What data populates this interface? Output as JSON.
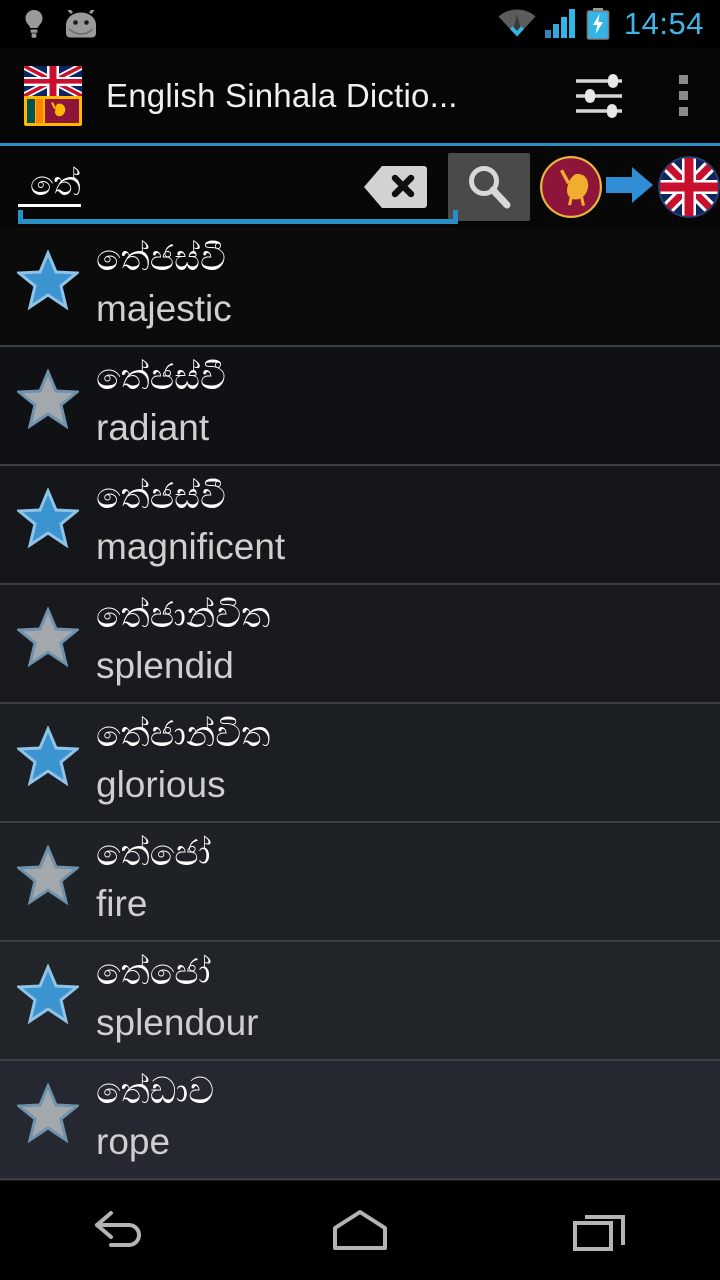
{
  "status_bar": {
    "left_icons": [
      {
        "name": "lightbulb-icon",
        "label": "lightbulb"
      },
      {
        "name": "android-face-icon",
        "label": "android"
      }
    ],
    "right_icons": [
      {
        "name": "wifi-icon",
        "label": "wifi"
      },
      {
        "name": "cellular-signal-icon",
        "label": "signal"
      },
      {
        "name": "battery-charging-icon",
        "label": "battery charging"
      }
    ],
    "clock": "14:54",
    "clock_color": "#41b4e6"
  },
  "action_bar": {
    "app_icon_name": "uk-srilanka-flag-icon",
    "title": "English Sinhala Dictio...",
    "tune_icon_name": "tune-sliders-icon",
    "overflow_icon_name": "overflow-menu-icon",
    "divider_color": "#2a8fc4"
  },
  "search": {
    "value": "තේ",
    "placeholder": "",
    "clear_icon_name": "clear-backspace-icon",
    "search_icon_name": "search-icon",
    "source_lang_icon_name": "sri-lanka-lion-flag-icon",
    "direction_icon_name": "arrow-right-icon",
    "target_lang_icon_name": "uk-flag-icon",
    "underline_color": "#2a8fc4"
  },
  "list": {
    "rows": [
      {
        "sinhala": "තේජස්වී",
        "english": "majestic",
        "starred": true,
        "star_color": "#3b93d0"
      },
      {
        "sinhala": "තේජස්වී",
        "english": "radiant",
        "starred": false,
        "star_color": "#a3a8ac"
      },
      {
        "sinhala": "තේජස්වී",
        "english": "magnificent",
        "starred": true,
        "star_color": "#3b93d0"
      },
      {
        "sinhala": "තේජාන්විත",
        "english": "splendid",
        "starred": false,
        "star_color": "#a3a8ac"
      },
      {
        "sinhala": "තේජාන්විත",
        "english": "glorious",
        "starred": true,
        "star_color": "#3b93d0"
      },
      {
        "sinhala": "තේජෝ",
        "english": "fire",
        "starred": false,
        "star_color": "#a3a8ac"
      },
      {
        "sinhala": "තේජෝ",
        "english": "splendour",
        "starred": true,
        "star_color": "#3b93d0"
      },
      {
        "sinhala": "තේඩාව",
        "english": "rope",
        "starred": false,
        "star_color": "#a3a8ac"
      }
    ],
    "row_backgrounds": [
      "#0b0b0c",
      "#101114",
      "#141619",
      "#181a1e",
      "#1b1e22",
      "#1e2126",
      "#212429",
      "#252830"
    ]
  },
  "nav_bar": {
    "back_label": "Back",
    "home_label": "Home",
    "recents_label": "Recent apps"
  }
}
